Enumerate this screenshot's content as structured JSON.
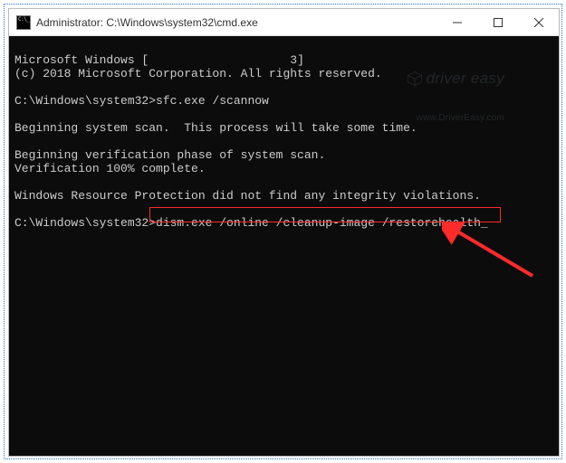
{
  "titlebar": {
    "title": "Administrator: C:\\Windows\\system32\\cmd.exe"
  },
  "console": {
    "line1_pre": "Microsoft Windows [",
    "line1_post": "3]",
    "line2": "(c) 2018 Microsoft Corporation. All rights reserved.",
    "blank": "",
    "prompt1": "C:\\Windows\\system32>",
    "cmd1": "sfc.exe /scannow",
    "line_scan": "Beginning system scan.  This process will take some time.",
    "line_verify": "Beginning verification phase of system scan.",
    "line_complete": "Verification 100% complete.",
    "line_wrp": "Windows Resource Protection did not find any integrity violations.",
    "prompt2": "C:\\Windows\\system32>",
    "cmd2": "dism.exe /online /cleanup-image /restorehealth",
    "cursor": "_"
  },
  "watermark": {
    "brand": "driver easy",
    "url": "www.DriverEasy.com"
  },
  "window_controls": {
    "minimize": "minimize",
    "maximize": "maximize",
    "close": "close"
  }
}
